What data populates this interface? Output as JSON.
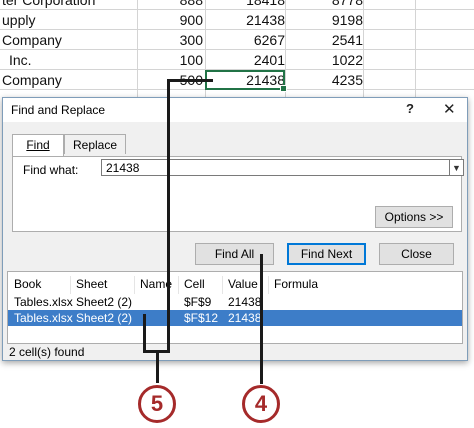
{
  "spreadsheet": {
    "rows": [
      {
        "name": "ter Corporation",
        "c1": "888",
        "c2": "18418",
        "c3": "8778"
      },
      {
        "name": "upply",
        "c1": "900",
        "c2": "21438",
        "c3": "9198"
      },
      {
        "name": "Company",
        "c1": "300",
        "c2": "6267",
        "c3": "2541"
      },
      {
        "name": "Inc.",
        "c1": "100",
        "c2": "2401",
        "c3": "1022"
      },
      {
        "name": "Company",
        "c1": "500",
        "c2": "21438",
        "c3": "4235"
      }
    ]
  },
  "dialog": {
    "title": "Find and Replace",
    "help_label": "?",
    "close_label": "✕",
    "tabs": [
      {
        "label": "Find"
      },
      {
        "label": "Replace"
      }
    ],
    "find_what_label": "Find what:",
    "find_what_value": "21438",
    "options_label": "Options >>",
    "find_all_label": "Find All",
    "find_next_label": "Find Next",
    "close_button_label": "Close",
    "results": {
      "headers": [
        "Book",
        "Sheet",
        "Name",
        "Cell",
        "Value",
        "Formula"
      ],
      "rows": [
        {
          "book": "Tables.xlsx",
          "sheet": "Sheet2 (2)",
          "name": "",
          "cell": "$F$9",
          "value": "21438",
          "formula": ""
        },
        {
          "book": "Tables.xlsx",
          "sheet": "Sheet2 (2)",
          "name": "",
          "cell": "$F$12",
          "value": "21438",
          "formula": ""
        }
      ],
      "selected_row": 1
    },
    "status": "2 cell(s) found"
  },
  "callouts": [
    {
      "label": "5",
      "color": "#a52a2a"
    },
    {
      "label": "4",
      "color": "#a52a2a"
    }
  ]
}
